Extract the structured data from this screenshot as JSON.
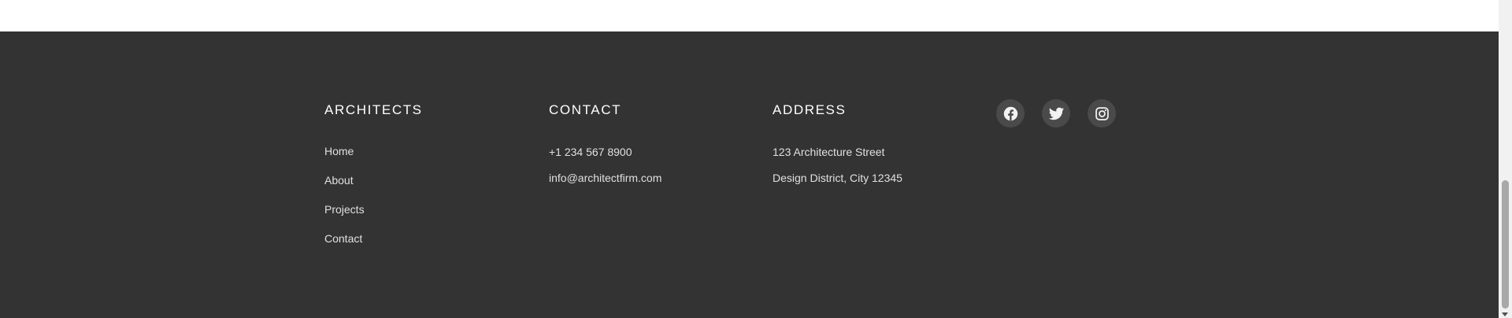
{
  "brand": {
    "title": "ARCHITECTS",
    "nav": [
      "Home",
      "About",
      "Projects",
      "Contact"
    ]
  },
  "contact": {
    "title": "CONTACT",
    "phone": "+1 234 567 8900",
    "email": "info@architectfirm.com"
  },
  "address": {
    "title": "ADDRESS",
    "line1": "123 Architecture Street",
    "line2": "Design District, City 12345"
  },
  "social": [
    "facebook-icon",
    "twitter-icon",
    "instagram-icon"
  ],
  "colors": {
    "footer_bg": "#333333",
    "heading": "#ffffff",
    "text": "#e0e0e0",
    "icon_bg": "#4a4a4a"
  }
}
